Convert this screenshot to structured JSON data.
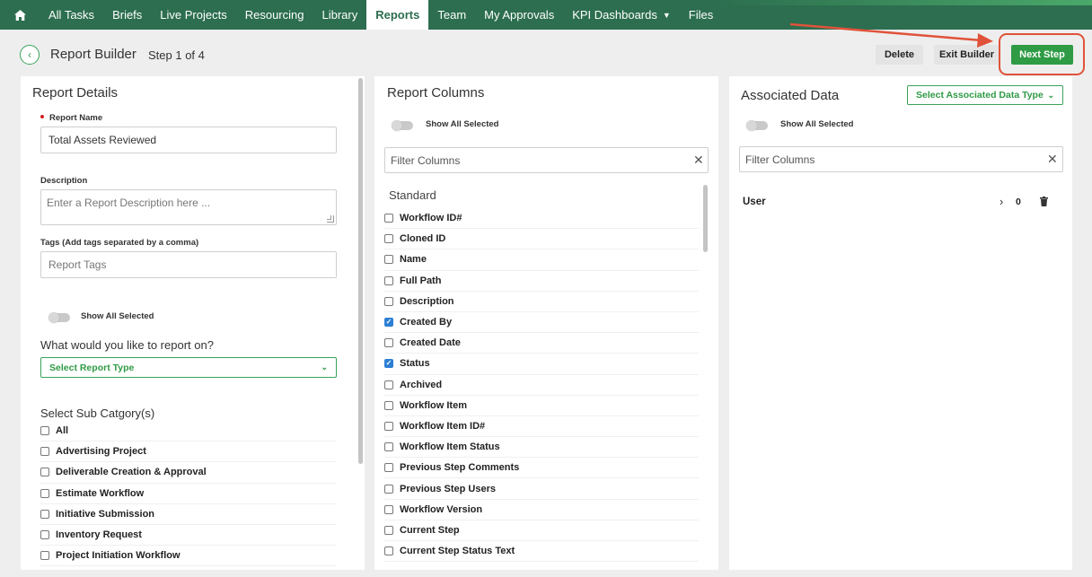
{
  "nav": {
    "items": [
      {
        "label": "All Tasks"
      },
      {
        "label": "Briefs"
      },
      {
        "label": "Live Projects"
      },
      {
        "label": "Resourcing"
      },
      {
        "label": "Library"
      },
      {
        "label": "Reports",
        "active": true
      },
      {
        "label": "Team"
      },
      {
        "label": "My Approvals"
      },
      {
        "label": "KPI Dashboards",
        "dropdown": true
      },
      {
        "label": "Files"
      }
    ]
  },
  "header": {
    "title": "Report Builder",
    "step": "Step 1 of 4",
    "delete_label": "Delete",
    "exit_label": "Exit Builder",
    "next_label": "Next Step"
  },
  "report_details": {
    "heading": "Report Details",
    "name_label": "Report Name",
    "name_value": "Total Assets Reviewed",
    "description_label": "Description",
    "description_placeholder": "Enter a Report Description here ...",
    "tags_label": "Tags (Add tags separated by a comma)",
    "tags_placeholder": "Report Tags",
    "show_all_label": "Show All Selected",
    "report_on_question": "What would you like to report on?",
    "report_type_placeholder": "Select Report Type",
    "sub_category_heading": "Select Sub Catgory(s)",
    "sub_categories": [
      {
        "label": "All",
        "checked": false
      },
      {
        "label": "Advertising Project",
        "checked": false
      },
      {
        "label": "Deliverable Creation & Approval",
        "checked": false
      },
      {
        "label": "Estimate Workflow",
        "checked": false
      },
      {
        "label": "Initiative Submission",
        "checked": false
      },
      {
        "label": "Inventory Request",
        "checked": false
      },
      {
        "label": "Project Initiation Workflow",
        "checked": false
      }
    ]
  },
  "report_columns": {
    "heading": "Report Columns",
    "show_all_label": "Show All Selected",
    "filter_placeholder": "Filter Columns",
    "group_title": "Standard",
    "columns": [
      {
        "label": "Workflow ID#",
        "checked": false
      },
      {
        "label": "Cloned ID",
        "checked": false
      },
      {
        "label": "Name",
        "checked": false
      },
      {
        "label": "Full Path",
        "checked": false
      },
      {
        "label": "Description",
        "checked": false
      },
      {
        "label": "Created By",
        "checked": true
      },
      {
        "label": "Created Date",
        "checked": false
      },
      {
        "label": "Status",
        "checked": true
      },
      {
        "label": "Archived",
        "checked": false
      },
      {
        "label": "Workflow Item",
        "checked": false
      },
      {
        "label": "Workflow Item ID#",
        "checked": false
      },
      {
        "label": "Workflow Item Status",
        "checked": false
      },
      {
        "label": "Previous Step Comments",
        "checked": false
      },
      {
        "label": "Previous Step Users",
        "checked": false
      },
      {
        "label": "Workflow Version",
        "checked": false
      },
      {
        "label": "Current Step",
        "checked": false
      },
      {
        "label": "Current Step Status Text",
        "checked": false
      }
    ]
  },
  "associated_data": {
    "heading": "Associated Data",
    "select_placeholder": "Select Associated Data Type",
    "show_all_label": "Show All Selected",
    "filter_placeholder": "Filter Columns",
    "rows": [
      {
        "label": "User",
        "count": "0"
      }
    ]
  },
  "colors": {
    "nav_bg": "#2c6e4f",
    "accent_green": "#2f9b45",
    "checkbox_blue": "#2d7fd4",
    "annotation_red": "#e0533a"
  }
}
